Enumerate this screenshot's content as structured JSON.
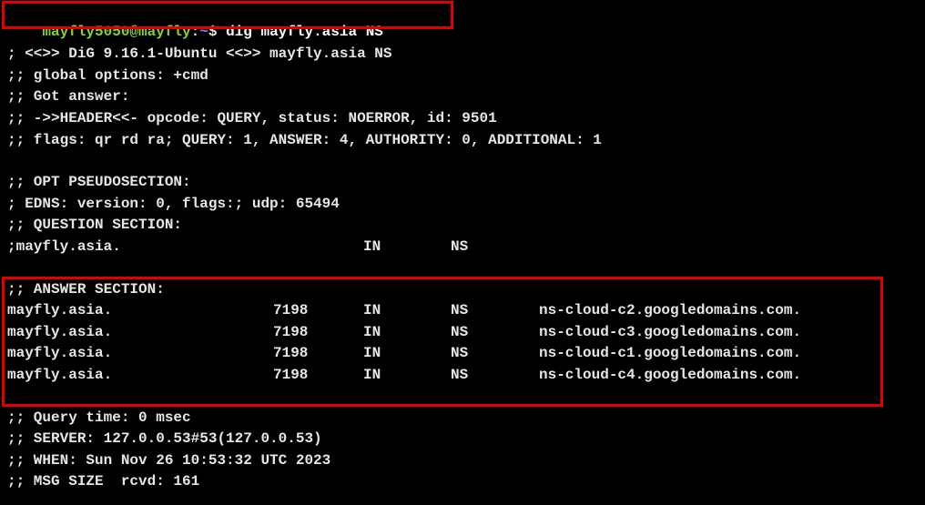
{
  "prompt": {
    "user_host": "mayfly5050@mayfly",
    "separator": ":",
    "path": "~",
    "symbol": "$ ",
    "command": "dig mayfly.asia NS"
  },
  "header_lines": [
    "; <<>> DiG 9.16.1-Ubuntu <<>> mayfly.asia NS",
    ";; global options: +cmd",
    ";; Got answer:",
    ";; ->>HEADER<<- opcode: QUERY, status: NOERROR, id: 9501",
    ";; flags: qr rd ra; QUERY: 1, ANSWER: 4, AUTHORITY: 0, ADDITIONAL: 1"
  ],
  "opt_lines": [
    ";; OPT PSEUDOSECTION:",
    "; EDNS: version: 0, flags:; udp: 65494",
    ";; QUESTION SECTION:"
  ],
  "question": {
    "name": ";mayfly.asia.",
    "class": "IN",
    "type": "NS"
  },
  "answer_title": ";; ANSWER SECTION:",
  "answers": [
    {
      "name": "mayfly.asia.",
      "ttl": "7198",
      "class": "IN",
      "type": "NS",
      "value": "ns-cloud-c2.googledomains.com."
    },
    {
      "name": "mayfly.asia.",
      "ttl": "7198",
      "class": "IN",
      "type": "NS",
      "value": "ns-cloud-c3.googledomains.com."
    },
    {
      "name": "mayfly.asia.",
      "ttl": "7198",
      "class": "IN",
      "type": "NS",
      "value": "ns-cloud-c1.googledomains.com."
    },
    {
      "name": "mayfly.asia.",
      "ttl": "7198",
      "class": "IN",
      "type": "NS",
      "value": "ns-cloud-c4.googledomains.com."
    }
  ],
  "footer_lines": [
    ";; Query time: 0 msec",
    ";; SERVER: 127.0.0.53#53(127.0.0.53)",
    ";; WHEN: Sun Nov 26 10:53:32 UTC 2023",
    ";; MSG SIZE  rcvd: 161"
  ],
  "colors": {
    "background": "#000000",
    "text": "#e6e6e6",
    "prompt_user": "#7fd62e",
    "prompt_path": "#6b8bff",
    "highlight_border": "#e00000"
  }
}
